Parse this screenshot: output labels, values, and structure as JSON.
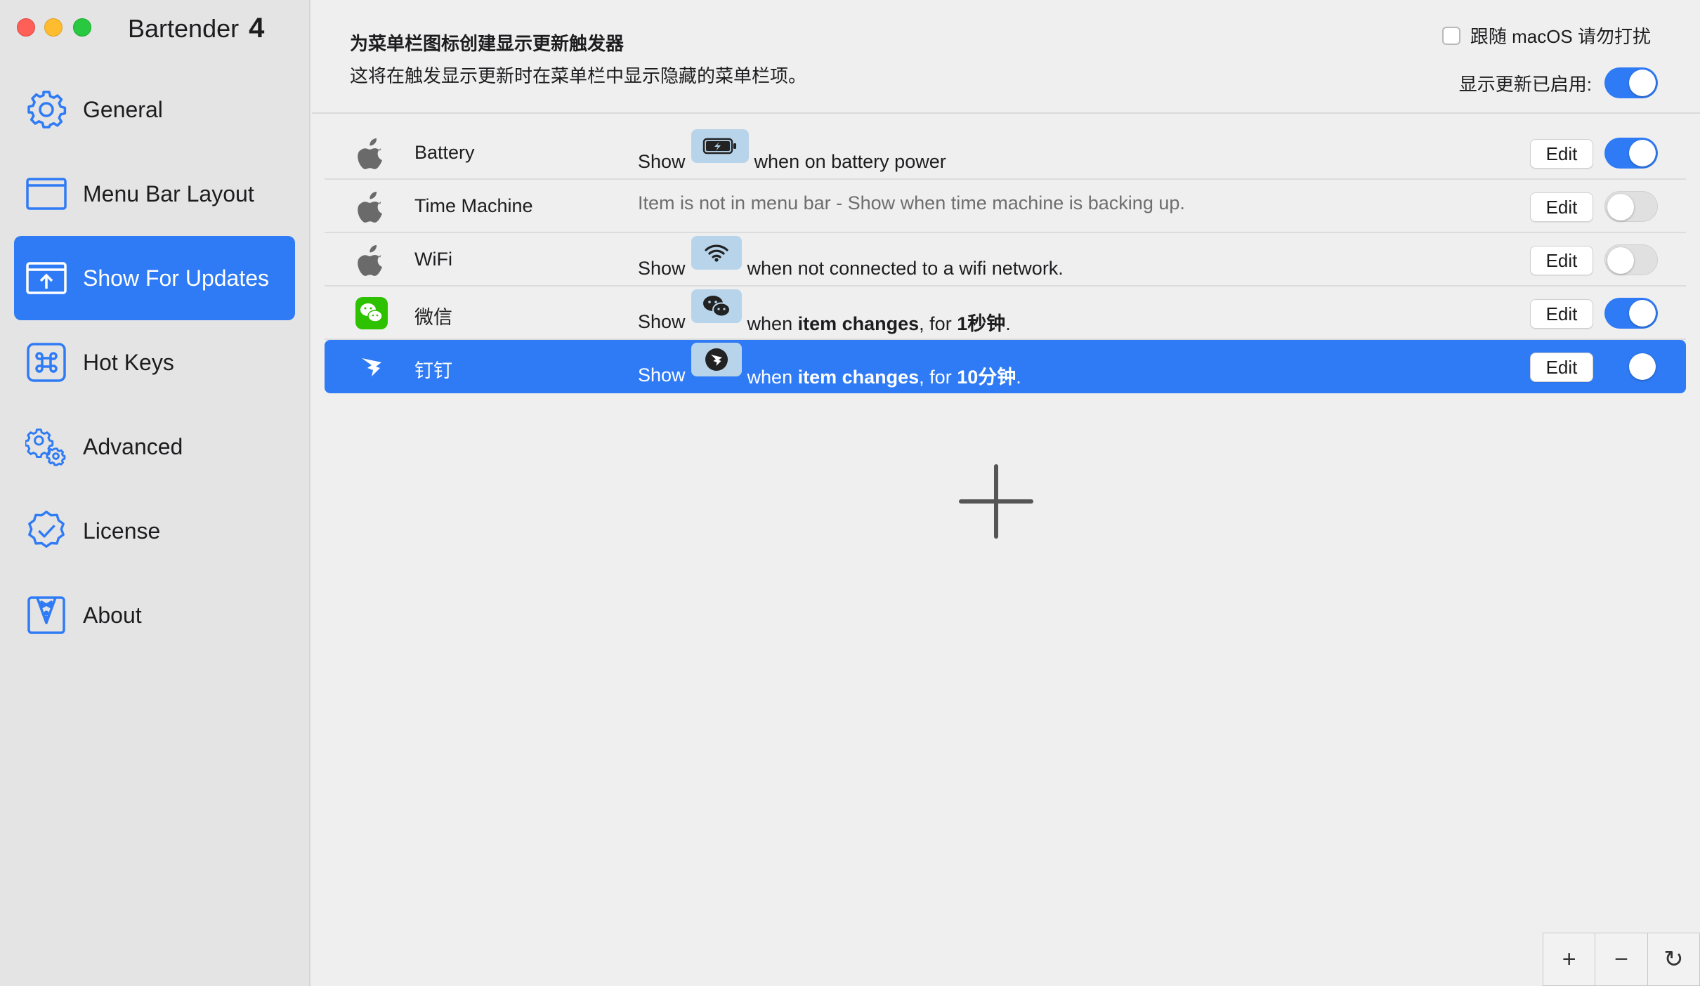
{
  "app": {
    "name": "Bartender",
    "version": "4"
  },
  "sidebar": {
    "items": [
      {
        "label": "General",
        "icon": "gear-icon",
        "active": false
      },
      {
        "label": "Menu Bar Layout",
        "icon": "menubar-window-icon",
        "active": false
      },
      {
        "label": "Show For Updates",
        "icon": "upload-window-icon",
        "active": true
      },
      {
        "label": "Hot Keys",
        "icon": "command-key-icon",
        "active": false
      },
      {
        "label": "Advanced",
        "icon": "gears-icon",
        "active": false
      },
      {
        "label": "License",
        "icon": "verified-badge-icon",
        "active": false
      },
      {
        "label": "About",
        "icon": "tuxedo-icon",
        "active": false
      }
    ]
  },
  "header": {
    "title": "为菜单栏图标创建显示更新触发器",
    "subtitle": "这将在触发显示更新时在菜单栏中显示隐藏的菜单栏项。",
    "dnd_label": "跟随 macOS 请勿打扰",
    "dnd_checked": false,
    "enabled_label": "显示更新已启用:",
    "enabled": true
  },
  "rows": [
    {
      "name": "Battery",
      "icon": "apple-icon",
      "show": "Show",
      "chip_icon": "battery-icon",
      "after": "when on battery power",
      "edit": "Edit",
      "on": true
    },
    {
      "name": "Time Machine",
      "icon": "apple-icon",
      "muted_text": "Item is not in menu bar - Show  when time machine is backing up.",
      "edit": "Edit",
      "on": false
    },
    {
      "name": "WiFi",
      "icon": "apple-icon",
      "show": "Show",
      "chip_icon": "wifi-icon",
      "after": "when not connected to a wifi network.",
      "edit": "Edit",
      "on": false
    },
    {
      "name": "微信",
      "icon": "wechat-icon",
      "show": "Show",
      "chip_icon": "wechat-glyph-icon",
      "when": "when ",
      "bold1": "item changes",
      "mid": ", for ",
      "bold2": "1秒钟",
      "end": ".",
      "edit": "Edit",
      "on": true
    },
    {
      "name": "钉钉",
      "icon": "dingtalk-icon",
      "show": "Show",
      "chip_icon": "dingtalk-glyph-icon",
      "when": "when ",
      "bold1": "item changes",
      "mid": ", for ",
      "bold2": "10分钟",
      "end": ".",
      "edit": "Edit",
      "on": true,
      "selected": true
    }
  ],
  "toolbar": {
    "add": "+",
    "remove": "−",
    "refresh": "↻"
  },
  "colors": {
    "accent": "#2f7bf5",
    "sidebar_bg": "#e4e4e4",
    "content_bg": "#efefef"
  }
}
